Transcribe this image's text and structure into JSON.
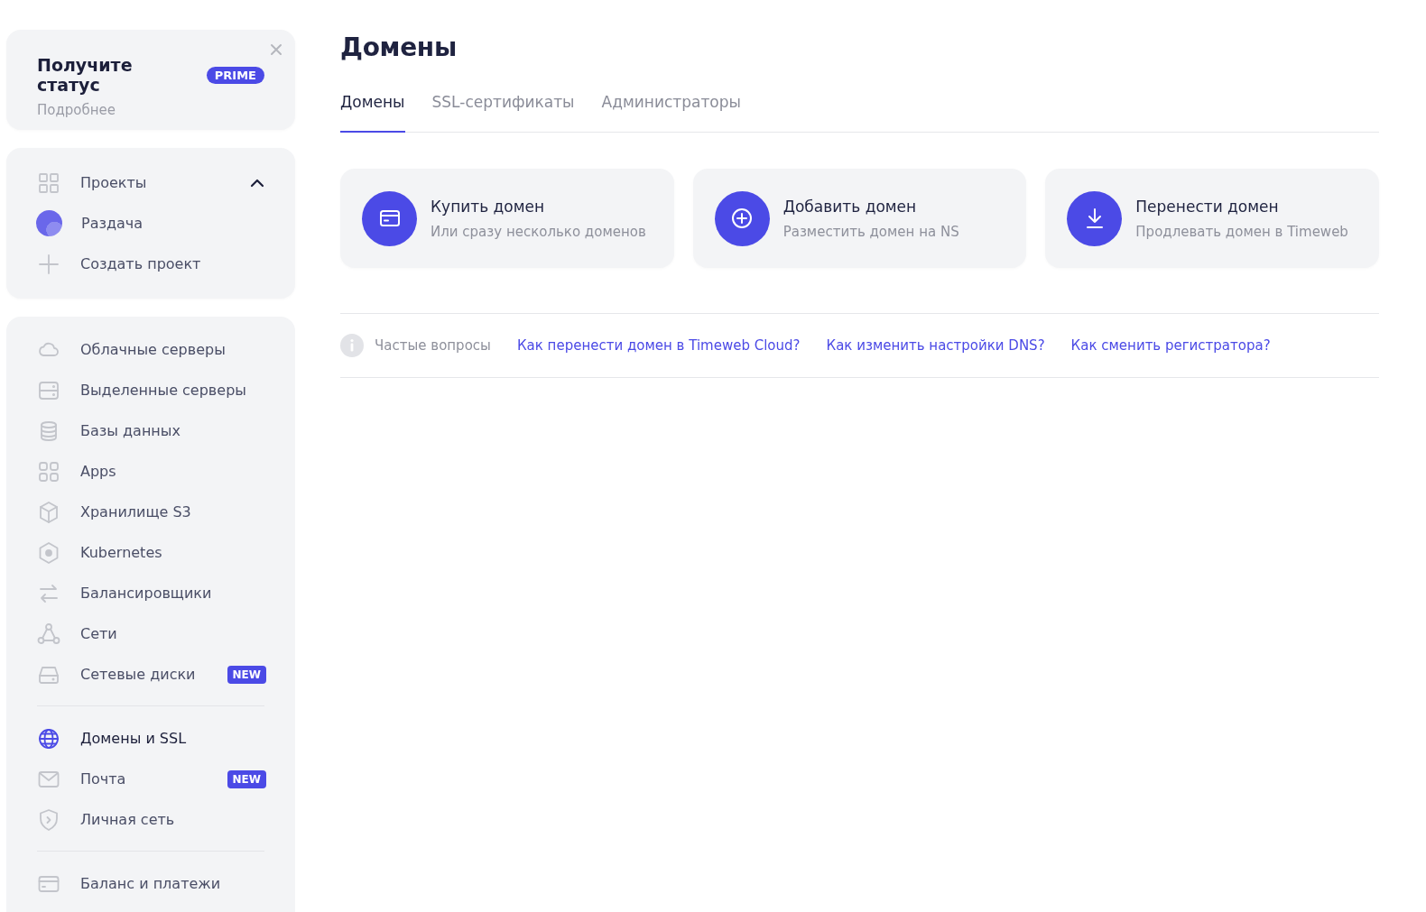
{
  "promo": {
    "title": "Получите статус",
    "badge": "PRIME",
    "link": "Подробнее"
  },
  "projects": {
    "label": "Проекты",
    "expanded": true,
    "items": [
      {
        "name": "Раздача"
      }
    ],
    "create": "Создать проект"
  },
  "nav_groups": [
    [
      {
        "label": "Облачные серверы",
        "selected": false
      },
      {
        "label": "Выделенные серверы",
        "selected": false
      },
      {
        "label": "Базы данных",
        "selected": false
      },
      {
        "label": "Apps",
        "selected": false
      },
      {
        "label": "Хранилище S3",
        "selected": false
      },
      {
        "label": "Kubernetes",
        "selected": false
      },
      {
        "label": "Балансировщики",
        "selected": false
      },
      {
        "label": "Сети",
        "selected": false
      },
      {
        "label": "Сетевые диски",
        "selected": false,
        "badge": "NEW"
      }
    ],
    [
      {
        "label": "Домены и SSL",
        "selected": true
      },
      {
        "label": "Почта",
        "selected": false,
        "badge": "NEW"
      },
      {
        "label": "Личная сеть",
        "selected": false
      }
    ],
    [
      {
        "label": "Баланс и платежи",
        "selected": false
      }
    ]
  ],
  "page": {
    "title": "Домены",
    "tabs": [
      {
        "label": "Домены",
        "selected": true
      },
      {
        "label": "SSL-сертификаты",
        "selected": false
      },
      {
        "label": "Администраторы",
        "selected": false
      }
    ],
    "actions": [
      {
        "title": "Купить домен",
        "subtitle": "Или сразу несколько доменов"
      },
      {
        "title": "Добавить домен",
        "subtitle": "Разместить домен на NS"
      },
      {
        "title": "Перенести домен",
        "subtitle": "Продлевать домен в Timeweb"
      }
    ],
    "faq": {
      "label": "Частые вопросы",
      "links": [
        "Как перенести домен в Timeweb Cloud?",
        "Как изменить настройки DNS?",
        "Как сменить регистратора?"
      ]
    }
  }
}
